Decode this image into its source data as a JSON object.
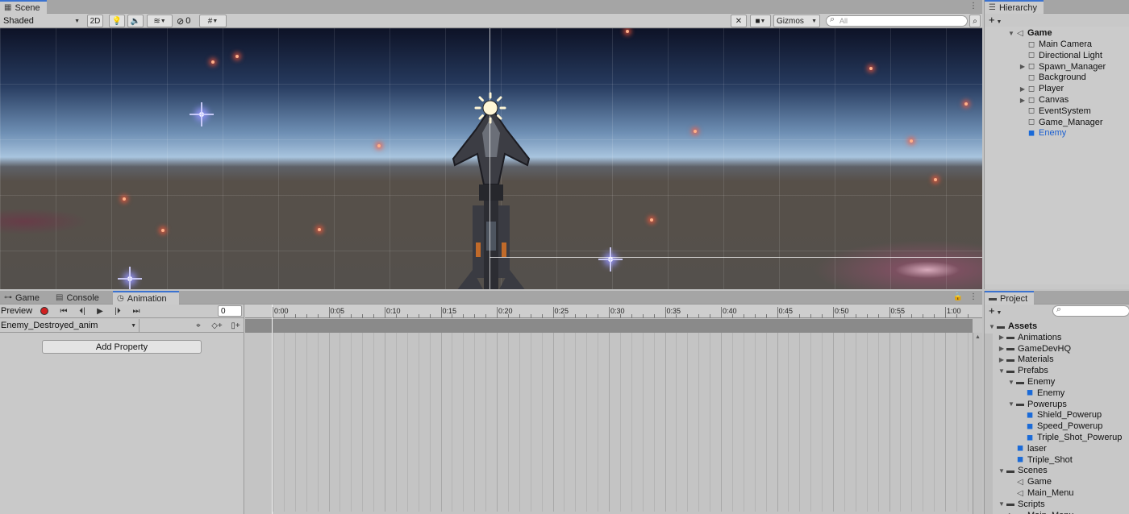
{
  "scene": {
    "tab_label": "Scene",
    "shading_mode": "Shaded",
    "mode_2d_label": "2D",
    "hidden_count": "0",
    "gizmos_label": "Gizmos",
    "search_placeholder": "All"
  },
  "hierarchy": {
    "tab_label": "Hierarchy",
    "scene_name": "Game",
    "items": [
      {
        "label": "Main Camera",
        "expandable": false,
        "selected": false
      },
      {
        "label": "Directional Light",
        "expandable": false,
        "selected": false
      },
      {
        "label": "Spawn_Manager",
        "expandable": true,
        "selected": false
      },
      {
        "label": "Background",
        "expandable": false,
        "selected": false
      },
      {
        "label": "Player",
        "expandable": true,
        "selected": false
      },
      {
        "label": "Canvas",
        "expandable": true,
        "selected": false
      },
      {
        "label": "EventSystem",
        "expandable": false,
        "selected": false
      },
      {
        "label": "Game_Manager",
        "expandable": false,
        "selected": false
      },
      {
        "label": "Enemy",
        "expandable": false,
        "selected": true
      }
    ]
  },
  "bottom_tabs": [
    {
      "label": "Game",
      "icon": "game-controller-icon"
    },
    {
      "label": "Console",
      "icon": "console-icon"
    },
    {
      "label": "Animation",
      "icon": "clock-icon"
    }
  ],
  "animation": {
    "preview_label": "Preview",
    "frame_value": "0",
    "clip_name": "Enemy_Destroyed_anim",
    "add_property_label": "Add Property",
    "ruler_labels": [
      "0:00",
      "0:05",
      "0:10",
      "0:15",
      "0:20",
      "0:25",
      "0:30",
      "0:35",
      "0:40",
      "0:45",
      "0:50",
      "0:55",
      "1:00"
    ]
  },
  "project": {
    "tab_label": "Project",
    "items": [
      {
        "label": "Assets",
        "depth": 0,
        "arrow": "open",
        "icon": "folder",
        "bold": true
      },
      {
        "label": "Animations",
        "depth": 1,
        "arrow": "closed",
        "icon": "folder"
      },
      {
        "label": "GameDevHQ",
        "depth": 1,
        "arrow": "closed",
        "icon": "folder"
      },
      {
        "label": "Materials",
        "depth": 1,
        "arrow": "closed",
        "icon": "folder"
      },
      {
        "label": "Prefabs",
        "depth": 1,
        "arrow": "open",
        "icon": "folder"
      },
      {
        "label": "Enemy",
        "depth": 2,
        "arrow": "open",
        "icon": "folder"
      },
      {
        "label": "Enemy",
        "depth": 3,
        "arrow": "none",
        "icon": "prefab"
      },
      {
        "label": "Powerups",
        "depth": 2,
        "arrow": "open",
        "icon": "folder"
      },
      {
        "label": "Shield_Powerup",
        "depth": 3,
        "arrow": "none",
        "icon": "prefab"
      },
      {
        "label": "Speed_Powerup",
        "depth": 3,
        "arrow": "none",
        "icon": "prefab"
      },
      {
        "label": "Triple_Shot_Powerup",
        "depth": 3,
        "arrow": "none",
        "icon": "prefab"
      },
      {
        "label": "laser",
        "depth": 2,
        "arrow": "none",
        "icon": "prefab"
      },
      {
        "label": "Triple_Shot",
        "depth": 2,
        "arrow": "none",
        "icon": "prefab"
      },
      {
        "label": "Scenes",
        "depth": 1,
        "arrow": "open",
        "icon": "folder"
      },
      {
        "label": "Game",
        "depth": 2,
        "arrow": "none",
        "icon": "scene"
      },
      {
        "label": "Main_Menu",
        "depth": 2,
        "arrow": "none",
        "icon": "scene"
      },
      {
        "label": "Scripts",
        "depth": 1,
        "arrow": "open",
        "icon": "folder"
      },
      {
        "label": "Main_Menu",
        "depth": 2,
        "arrow": "closed",
        "icon": "folder"
      }
    ]
  },
  "colors": {
    "selection_blue": "#1a5fd0",
    "active_tab_accent": "#3a72d0",
    "record_red": "#d02020"
  }
}
